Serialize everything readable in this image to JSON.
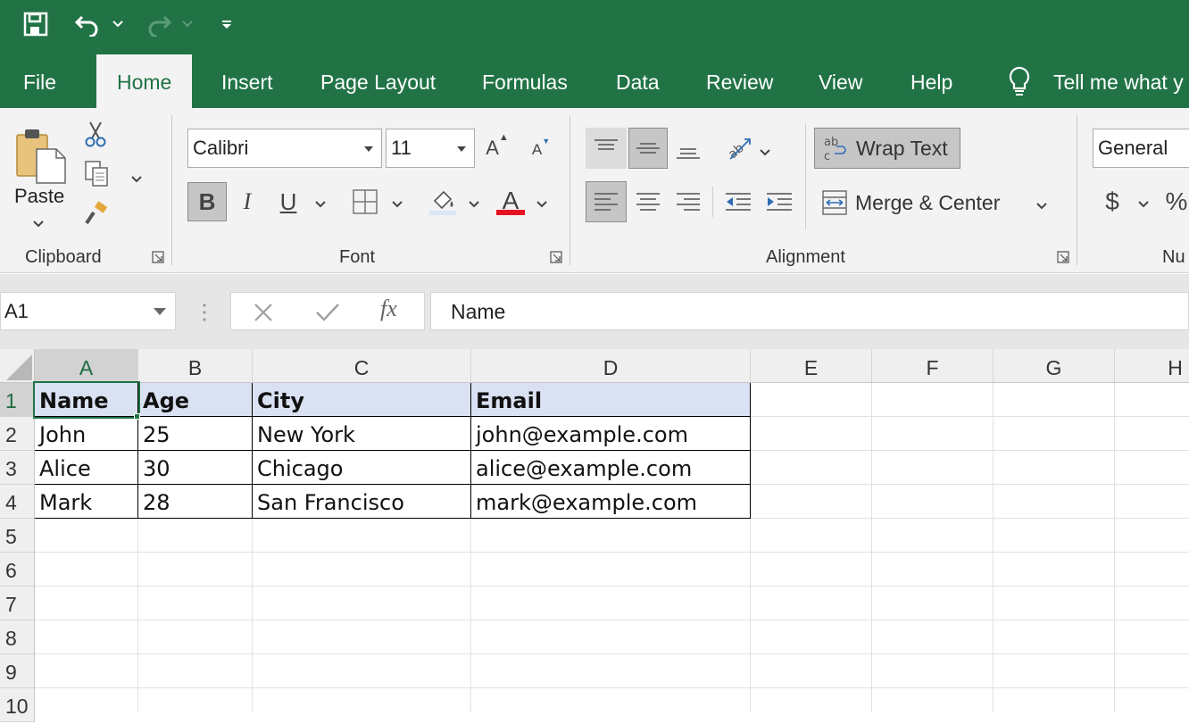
{
  "qat": {
    "save_icon": "save-icon",
    "undo_icon": "undo-icon",
    "redo_icon": "redo-icon"
  },
  "tabs": [
    "File",
    "Home",
    "Insert",
    "Page Layout",
    "Formulas",
    "Data",
    "Review",
    "View",
    "Help"
  ],
  "tell_me": "Tell me what y",
  "clipboard": {
    "paste": "Paste",
    "label": "Clipboard"
  },
  "font": {
    "name": "Calibri",
    "size": "11",
    "bold": "B",
    "italic": "I",
    "underline": "U",
    "label": "Font",
    "color_letter": "A",
    "font_color": "#e81123",
    "grow": "A",
    "shrink": "A"
  },
  "alignment": {
    "wrap_text": "Wrap Text",
    "merge_center": "Merge & Center",
    "label": "Alignment"
  },
  "number": {
    "format": "General",
    "currency": "$",
    "percent": "%",
    "label": "Nu"
  },
  "formula_bar": {
    "name_box": "A1",
    "fx": "fx",
    "content": "Name"
  },
  "grid": {
    "columns": [
      "A",
      "B",
      "C",
      "D",
      "E",
      "F",
      "G",
      "H"
    ],
    "rows": [
      "1",
      "2",
      "3",
      "4",
      "5",
      "6",
      "7",
      "8",
      "9",
      "10"
    ],
    "data": [
      [
        "Name",
        "Age",
        "City",
        "Email"
      ],
      [
        "John",
        "25",
        "New York",
        "john@example.com"
      ],
      [
        "Alice",
        "30",
        "Chicago",
        "alice@example.com"
      ],
      [
        "Mark",
        "28",
        "San Francisco",
        "mark@example.com"
      ]
    ]
  },
  "colors": {
    "brand": "#217346",
    "header_fill": "#d9e1f2"
  }
}
